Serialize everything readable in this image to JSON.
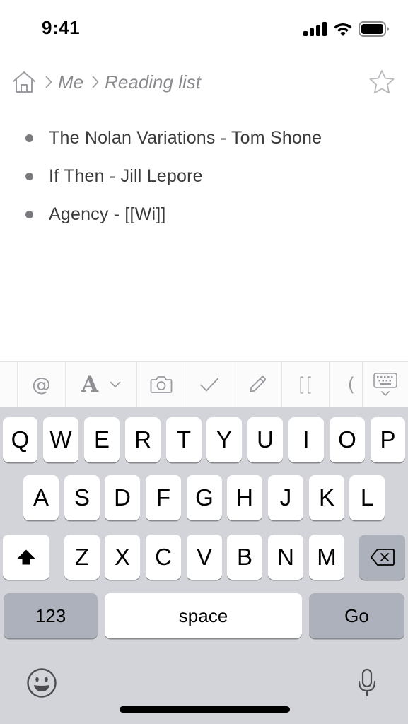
{
  "status_bar": {
    "time": "9:41",
    "icons": [
      "cellular-signal-icon",
      "wifi-icon",
      "battery-icon"
    ]
  },
  "breadcrumb": {
    "items": [
      {
        "label": "Me"
      },
      {
        "label": "Reading list"
      }
    ],
    "icons": [
      "home-icon",
      "chevron-right-icon",
      "star-icon"
    ]
  },
  "list": {
    "items": [
      {
        "text": "The Nolan Variations - Tom Shone"
      },
      {
        "text": "If Then - Jill Lepore"
      },
      {
        "text": "Agency - [[Wi]]"
      }
    ]
  },
  "toolbar": {
    "mention": "@",
    "format": "A",
    "link": "[[",
    "paren": "(",
    "icons": [
      "at-icon",
      "text-format-icon",
      "chevron-down-icon",
      "camera-icon",
      "checkmark-icon",
      "pencil-icon",
      "keyboard-dismiss-icon"
    ]
  },
  "keyboard": {
    "row1": [
      "Q",
      "W",
      "E",
      "R",
      "T",
      "Y",
      "U",
      "I",
      "O",
      "P"
    ],
    "row2": [
      "A",
      "S",
      "D",
      "F",
      "G",
      "H",
      "J",
      "K",
      "L"
    ],
    "row3": [
      "Z",
      "X",
      "C",
      "V",
      "B",
      "N",
      "M"
    ],
    "numbers_label": "123",
    "space_label": "space",
    "go_label": "Go",
    "icons": [
      "shift-icon",
      "delete-icon",
      "emoji-icon",
      "microphone-icon"
    ]
  },
  "colors": {
    "keyboard_bg": "#d2d4da",
    "key_bg": "#ffffff",
    "function_key_bg": "#adb1bb",
    "breadcrumb_text": "#8a8a8e"
  }
}
